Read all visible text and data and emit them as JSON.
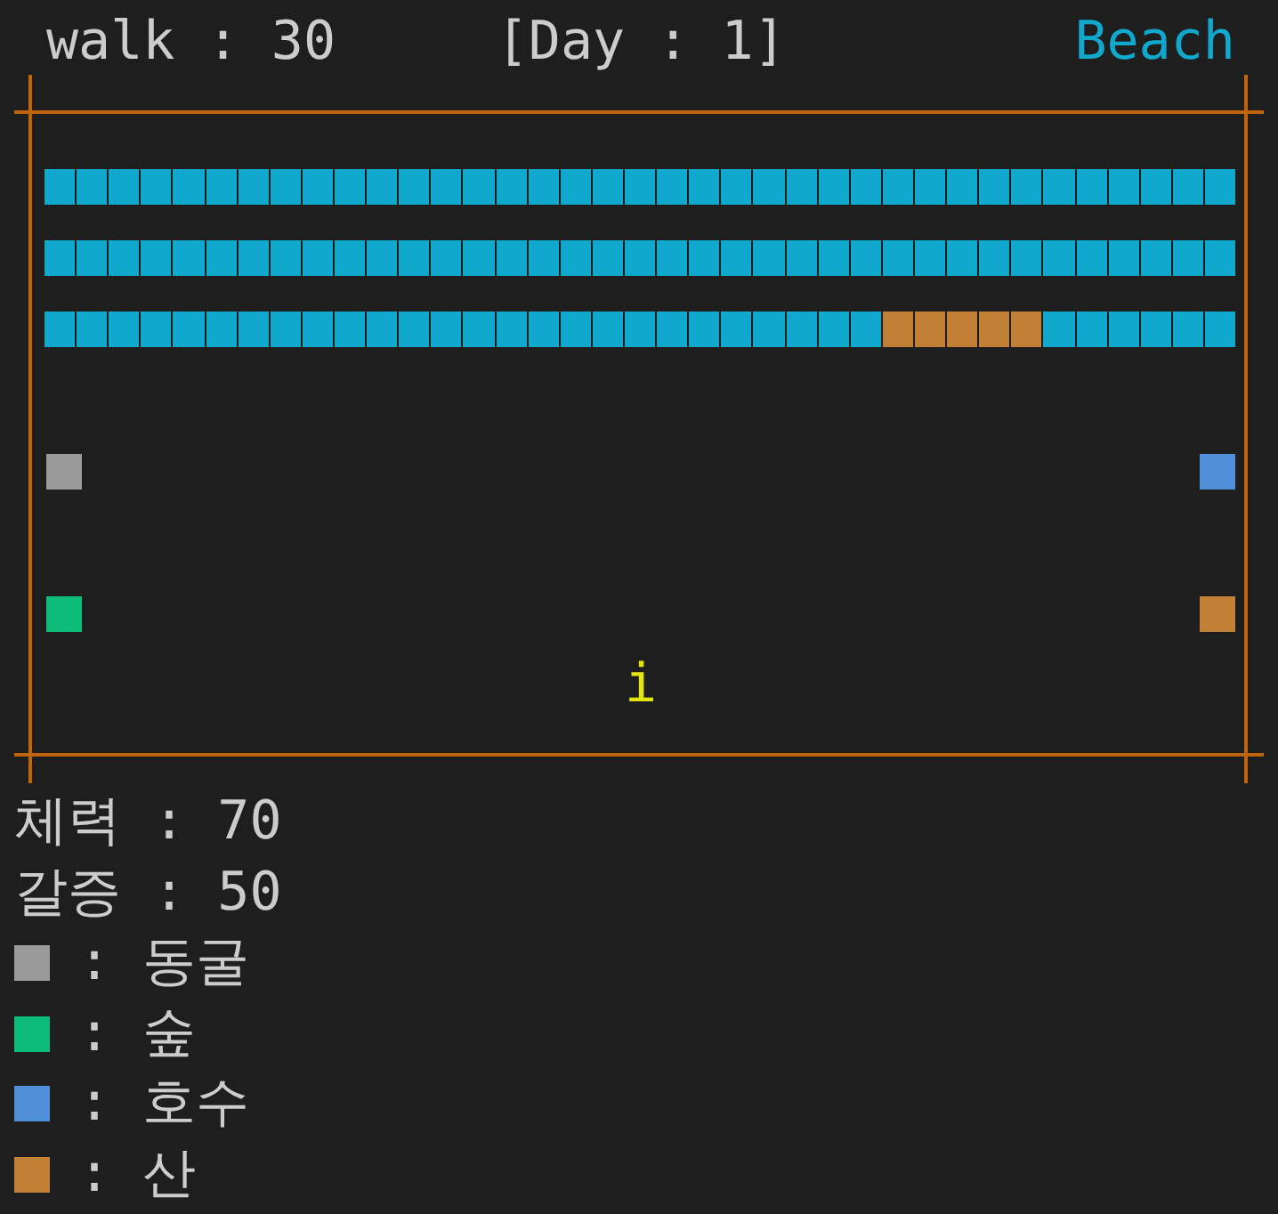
{
  "header": {
    "walk": "walk : 30",
    "day": "[Day : 1]",
    "location": "Beach"
  },
  "map": {
    "tile_rows": [
      {
        "tiles": [
          {
            "color": "#11a8cd"
          },
          {
            "color": "#11a8cd"
          },
          {
            "color": "#11a8cd"
          },
          {
            "color": "#11a8cd"
          },
          {
            "color": "#11a8cd"
          },
          {
            "color": "#11a8cd"
          },
          {
            "color": "#11a8cd"
          },
          {
            "color": "#11a8cd"
          },
          {
            "color": "#11a8cd"
          },
          {
            "color": "#11a8cd"
          },
          {
            "color": "#11a8cd"
          },
          {
            "color": "#11a8cd"
          },
          {
            "color": "#11a8cd"
          },
          {
            "color": "#11a8cd"
          },
          {
            "color": "#11a8cd"
          },
          {
            "color": "#11a8cd"
          },
          {
            "color": "#11a8cd"
          },
          {
            "color": "#11a8cd"
          },
          {
            "color": "#11a8cd"
          },
          {
            "color": "#11a8cd"
          },
          {
            "color": "#11a8cd"
          },
          {
            "color": "#11a8cd"
          },
          {
            "color": "#11a8cd"
          },
          {
            "color": "#11a8cd"
          },
          {
            "color": "#11a8cd"
          },
          {
            "color": "#11a8cd"
          },
          {
            "color": "#11a8cd"
          },
          {
            "color": "#11a8cd"
          },
          {
            "color": "#11a8cd"
          },
          {
            "color": "#11a8cd"
          },
          {
            "color": "#11a8cd"
          },
          {
            "color": "#11a8cd"
          },
          {
            "color": "#11a8cd"
          },
          {
            "color": "#11a8cd"
          },
          {
            "color": "#11a8cd"
          },
          {
            "color": "#11a8cd"
          },
          {
            "color": "#11a8cd"
          }
        ]
      },
      {
        "tiles": [
          {
            "color": "#11a8cd"
          },
          {
            "color": "#11a8cd"
          },
          {
            "color": "#11a8cd"
          },
          {
            "color": "#11a8cd"
          },
          {
            "color": "#11a8cd"
          },
          {
            "color": "#11a8cd"
          },
          {
            "color": "#11a8cd"
          },
          {
            "color": "#11a8cd"
          },
          {
            "color": "#11a8cd"
          },
          {
            "color": "#11a8cd"
          },
          {
            "color": "#11a8cd"
          },
          {
            "color": "#11a8cd"
          },
          {
            "color": "#11a8cd"
          },
          {
            "color": "#11a8cd"
          },
          {
            "color": "#11a8cd"
          },
          {
            "color": "#11a8cd"
          },
          {
            "color": "#11a8cd"
          },
          {
            "color": "#11a8cd"
          },
          {
            "color": "#11a8cd"
          },
          {
            "color": "#11a8cd"
          },
          {
            "color": "#11a8cd"
          },
          {
            "color": "#11a8cd"
          },
          {
            "color": "#11a8cd"
          },
          {
            "color": "#11a8cd"
          },
          {
            "color": "#11a8cd"
          },
          {
            "color": "#11a8cd"
          },
          {
            "color": "#11a8cd"
          },
          {
            "color": "#11a8cd"
          },
          {
            "color": "#11a8cd"
          },
          {
            "color": "#11a8cd"
          },
          {
            "color": "#11a8cd"
          },
          {
            "color": "#11a8cd"
          },
          {
            "color": "#11a8cd"
          },
          {
            "color": "#11a8cd"
          },
          {
            "color": "#11a8cd"
          },
          {
            "color": "#11a8cd"
          },
          {
            "color": "#11a8cd"
          }
        ]
      },
      {
        "tiles": [
          {
            "color": "#11a8cd"
          },
          {
            "color": "#11a8cd"
          },
          {
            "color": "#11a8cd"
          },
          {
            "color": "#11a8cd"
          },
          {
            "color": "#11a8cd"
          },
          {
            "color": "#11a8cd"
          },
          {
            "color": "#11a8cd"
          },
          {
            "color": "#11a8cd"
          },
          {
            "color": "#11a8cd"
          },
          {
            "color": "#11a8cd"
          },
          {
            "color": "#11a8cd"
          },
          {
            "color": "#11a8cd"
          },
          {
            "color": "#11a8cd"
          },
          {
            "color": "#11a8cd"
          },
          {
            "color": "#11a8cd"
          },
          {
            "color": "#11a8cd"
          },
          {
            "color": "#11a8cd"
          },
          {
            "color": "#11a8cd"
          },
          {
            "color": "#11a8cd"
          },
          {
            "color": "#11a8cd"
          },
          {
            "color": "#11a8cd"
          },
          {
            "color": "#11a8cd"
          },
          {
            "color": "#11a8cd"
          },
          {
            "color": "#11a8cd"
          },
          {
            "color": "#11a8cd"
          },
          {
            "color": "#11a8cd"
          },
          {
            "color": "#c27f36"
          },
          {
            "color": "#c27f36"
          },
          {
            "color": "#c27f36"
          },
          {
            "color": "#c27f36"
          },
          {
            "color": "#c27f36"
          },
          {
            "color": "#11a8cd"
          },
          {
            "color": "#11a8cd"
          },
          {
            "color": "#11a8cd"
          },
          {
            "color": "#11a8cd"
          },
          {
            "color": "#11a8cd"
          },
          {
            "color": "#11a8cd"
          }
        ]
      }
    ],
    "landmark_rows": [
      {
        "left": {
          "color": "#9a9a9a"
        },
        "right": {
          "color": "#4f8fd8"
        }
      },
      {
        "left": {
          "color": "#0dbc79"
        },
        "right": {
          "color": "#c27f36"
        }
      }
    ],
    "player": {
      "glyph": "i"
    }
  },
  "stats": [
    "체력 : 70",
    "갈증 : 50"
  ],
  "legend": [
    {
      "color": "#9a9a9a",
      "text": ": 동굴"
    },
    {
      "color": "#0dbc79",
      "text": ": 숲"
    },
    {
      "color": "#4f8fd8",
      "text": ": 호수"
    },
    {
      "color": "#c27f36",
      "text": ": 산"
    }
  ]
}
